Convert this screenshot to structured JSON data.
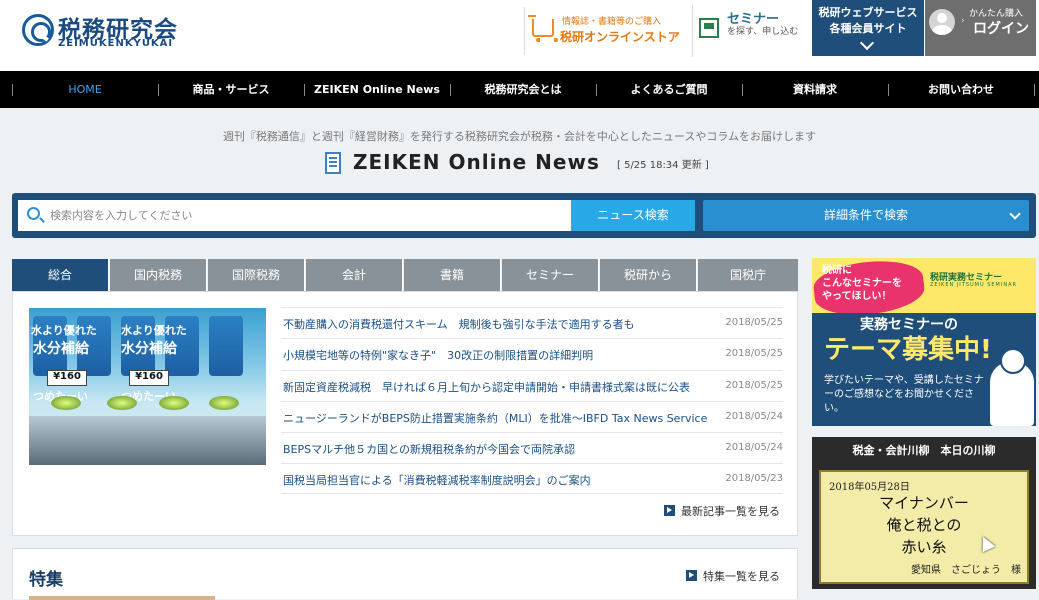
{
  "header": {
    "logo_text": "税務研究会",
    "logo_sub": "ZEIMUKENKYUKAI",
    "store_line1": "情報誌・書籍等のご購入",
    "store_line2": "税研オンラインストア",
    "seminar_title": "セミナー",
    "seminar_sub": "を探す、申し込む",
    "websvc_line1": "税研ウェブサービス",
    "websvc_line2": "各種会員サイト",
    "login_line1": "かんたん購入",
    "login_line2": "ログイン"
  },
  "nav": {
    "items": [
      {
        "label": "HOME",
        "active": true
      },
      {
        "label": "商品・サービス"
      },
      {
        "label": "ZEIKEN Online News"
      },
      {
        "label": "税務研究会とは"
      },
      {
        "label": "よくあるご質問"
      },
      {
        "label": "資料請求"
      },
      {
        "label": "お問い合わせ"
      }
    ]
  },
  "intro": {
    "tagline": "週刊『税務通信』と週刊『経営財務』を発行する税務研究会が税務・会計を中心としたニュースやコラムをお届けします",
    "title": "ZEIKEN Online News",
    "updated": "[ 5/25 18:34 更新 ]"
  },
  "search": {
    "placeholder": "検索内容を入力してください",
    "value": "",
    "button": "ニュース検索",
    "advanced": "詳細条件で検索"
  },
  "tabs": [
    {
      "label": "総合",
      "active": true
    },
    {
      "label": "国内税務"
    },
    {
      "label": "国際税務"
    },
    {
      "label": "会計"
    },
    {
      "label": "書籍"
    },
    {
      "label": "セミナー"
    },
    {
      "label": "税研から"
    },
    {
      "label": "国税庁"
    }
  ],
  "image": {
    "label1": "水より優れた",
    "label2": "水分補給",
    "price": "¥160",
    "slogan": "つめたーい"
  },
  "news": [
    {
      "title": "不動産購入の消費税還付スキーム　規制後も強引な手法で適用する者も",
      "date": "2018/05/25"
    },
    {
      "title": "小規模宅地等の特例\"家なき子\"　30改正の制限措置の詳細判明",
      "date": "2018/05/25"
    },
    {
      "title": "新固定資産税減税　早ければ６月上旬から認定申請開始・申請書様式案は既に公表",
      "date": "2018/05/25"
    },
    {
      "title": "ニュージーランドがBEPS防止措置実施条約（MLI）を批准～IBFD Tax News Service",
      "date": "2018/05/24"
    },
    {
      "title": "BEPSマルチ他５カ国との新規租税条約が今国会で両院承認",
      "date": "2018/05/24"
    },
    {
      "title": "国税当局担当官による「消費税軽減税率制度説明会」のご案内",
      "date": "2018/05/23"
    }
  ],
  "news_more": "最新記事一覧を見る",
  "feature": {
    "title": "特集",
    "more": "特集一覧を見る"
  },
  "banner1": {
    "bubble_line1": "税研に",
    "bubble_line2": "こんなセミナーを",
    "bubble_line3": "やってほしい！",
    "logo": "税研実務セミナー",
    "logo_sub": "ZEIKEN JITSUMU SEMINAR",
    "line1": "実務セミナーの",
    "line2": "テーマ募集中!",
    "desc": "学びたいテーマや、受講したセミナーのご感想などをお聞かせください。"
  },
  "banner2": {
    "head": "税金・会計川柳　本日の川柳",
    "date": "2018年05月28日",
    "line1": "マイナンバー",
    "line2": "俺と税との",
    "line3": "赤い糸",
    "author": "愛知県　さごじょう　様"
  }
}
